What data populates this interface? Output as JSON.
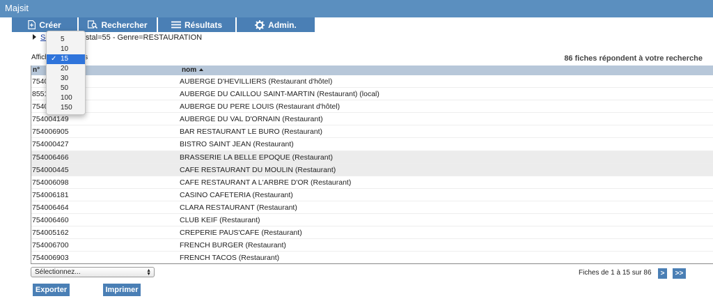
{
  "app": {
    "title": "Majsit"
  },
  "nav": [
    {
      "label": "Créer",
      "icon": "new-document-icon"
    },
    {
      "label": "Rechercher",
      "icon": "search-icon"
    },
    {
      "label": "Résultats",
      "icon": "list-icon"
    },
    {
      "label": "Admin.",
      "icon": "gear-icon"
    }
  ],
  "filter": {
    "link": "Se",
    "text": "de postal=55 - Genre=RESTAURATION"
  },
  "display": {
    "prefix": "Affich",
    "suffix": "lignes"
  },
  "results_count": "86 fiches répondent à votre recherche",
  "table": {
    "headers": {
      "num": "n°",
      "nom": "nom"
    },
    "rows": [
      {
        "num": "754000",
        "nom": "AUBERGE D'HEVILLIERS (Restaurant d'hôtel)"
      },
      {
        "num": "8551",
        "nom": "AUBERGE DU CAILLOU SAINT-MARTIN (Restaurant) (local)"
      },
      {
        "num": "7540",
        "nom": "AUBERGE DU PERE LOUIS (Restaurant d'hôtel)"
      },
      {
        "num": "754004149",
        "nom": "AUBERGE DU VAL D'ORNAIN (Restaurant)"
      },
      {
        "num": "754006905",
        "nom": "BAR RESTAURANT LE BURO (Restaurant)"
      },
      {
        "num": "754000427",
        "nom": "BISTRO SAINT JEAN (Restaurant)"
      },
      {
        "num": "754006466",
        "nom": "BRASSERIE LA BELLE EPOQUE (Restaurant)"
      },
      {
        "num": "754000445",
        "nom": "CAFE RESTAURANT DU MOULIN (Restaurant)"
      },
      {
        "num": "754006098",
        "nom": "CAFE RESTAURANT A L'ARBRE D'OR (Restaurant)"
      },
      {
        "num": "754006181",
        "nom": "CASINO CAFETERIA (Restaurant)"
      },
      {
        "num": "754006464",
        "nom": "CLARA RESTAURANT (Restaurant)"
      },
      {
        "num": "754006460",
        "nom": "CLUB KEIF (Restaurant)"
      },
      {
        "num": "754005162",
        "nom": "CREPERIE PAUS'CAFE (Restaurant)"
      },
      {
        "num": "754006700",
        "nom": "FRENCH BURGER (Restaurant)"
      },
      {
        "num": "754006903",
        "nom": "FRENCH TACOS (Restaurant)"
      }
    ]
  },
  "page_size": {
    "options": [
      "5",
      "10",
      "15",
      "20",
      "30",
      "50",
      "100",
      "150"
    ],
    "selected": "15"
  },
  "action_select": {
    "value": "Sélectionnez..."
  },
  "pager": {
    "text": "Fiches de 1 à 15 sur 86",
    "next": ">",
    "last": ">>"
  },
  "buttons": {
    "export": "Exporter",
    "print": "Imprimer"
  },
  "colors": {
    "titlebar": "#5b8fbf",
    "button": "#4a7fb5",
    "header": "#b7c7d9",
    "selection": "#2f74db"
  }
}
